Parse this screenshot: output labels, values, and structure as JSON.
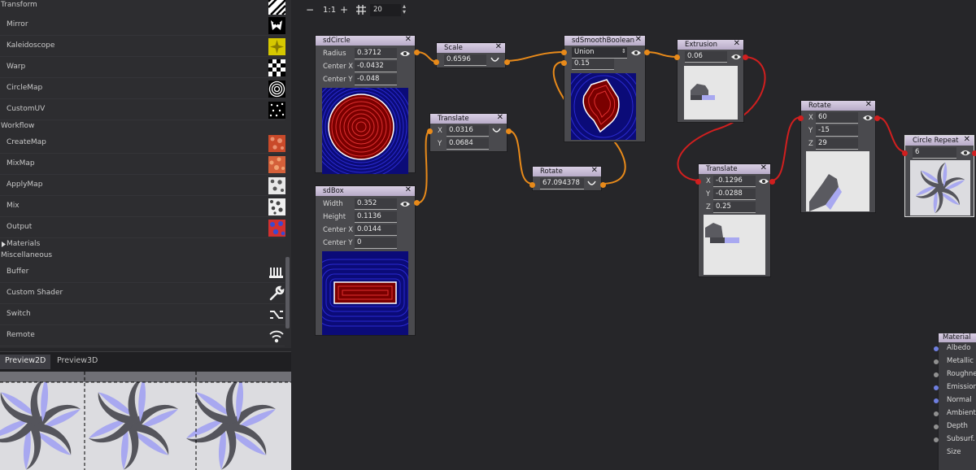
{
  "library": {
    "rows": [
      {
        "label": "Transform",
        "kind": "category"
      },
      {
        "label": "Mirror",
        "icon": "mirror-thumb-icon"
      },
      {
        "label": "Kaleidoscope",
        "icon": "kaleidoscope-thumb-icon"
      },
      {
        "label": "Warp",
        "icon": "warp-thumb-icon"
      },
      {
        "label": "CircleMap",
        "icon": "circlemap-thumb-icon"
      },
      {
        "label": "CustomUV",
        "icon": "customuv-thumb-icon"
      },
      {
        "label": "Workflow",
        "kind": "category"
      },
      {
        "label": "CreateMap",
        "icon": "createmap-thumb-icon"
      },
      {
        "label": "MixMap",
        "icon": "mixmap-thumb-icon"
      },
      {
        "label": "ApplyMap",
        "icon": "applymap-thumb-icon"
      },
      {
        "label": "Mix",
        "icon": "mix-thumb-icon"
      },
      {
        "label": "Output",
        "icon": "output-thumb-icon"
      },
      {
        "label": "Materials",
        "kind": "collapsed-category"
      },
      {
        "label": "Miscellaneous",
        "kind": "category"
      },
      {
        "label": "Buffer",
        "icon": "buffer-icon"
      },
      {
        "label": "Custom Shader",
        "icon": "wrench-icon"
      },
      {
        "label": "Switch",
        "icon": "switch-icon"
      },
      {
        "label": "Remote",
        "icon": "remote-icon"
      }
    ]
  },
  "preview": {
    "tabs": [
      {
        "label": "Preview2D",
        "active": true
      },
      {
        "label": "Preview3D",
        "active": false
      }
    ]
  },
  "toolbar": {
    "zoom_out": "−",
    "zoom_reset": "1:1",
    "zoom_in": "+",
    "grid_icon": "snap-grid-icon",
    "grid_value": "20",
    "spin": "▲▼"
  },
  "nodes": {
    "sdcircle": {
      "title": "sdCircle",
      "params": [
        {
          "label": "Radius",
          "value": "0.3712"
        },
        {
          "label": "Center X",
          "value": "-0.0432"
        },
        {
          "label": "Center Y",
          "value": "-0.048"
        }
      ]
    },
    "sdbox": {
      "title": "sdBox",
      "params": [
        {
          "label": "Width",
          "value": "0.352"
        },
        {
          "label": "Height",
          "value": "0.1136"
        },
        {
          "label": "Center X",
          "value": "0.0144"
        },
        {
          "label": "Center Y",
          "value": "0"
        }
      ]
    },
    "scale": {
      "title": "Scale",
      "value": "0.6596"
    },
    "translate1": {
      "title": "Translate",
      "params": [
        {
          "label": "X",
          "value": "0.0316"
        },
        {
          "label": "Y",
          "value": "0.0684"
        }
      ]
    },
    "rotate1": {
      "title": "Rotate",
      "value": "67.094378"
    },
    "smoothbool": {
      "title": "sdSmoothBoolean",
      "op": "Union",
      "value": "0.15"
    },
    "extrusion": {
      "title": "Extrusion",
      "value": "0.06"
    },
    "translate2": {
      "title": "Translate",
      "params": [
        {
          "label": "X",
          "value": "-0.1296"
        },
        {
          "label": "Y",
          "value": "-0.0288"
        },
        {
          "label": "Z",
          "value": "0.25"
        }
      ]
    },
    "rotate2": {
      "title": "Rotate",
      "params": [
        {
          "label": "X",
          "value": "60"
        },
        {
          "label": "Y",
          "value": "-15"
        },
        {
          "label": "Z",
          "value": "29"
        }
      ]
    },
    "circlerepeat": {
      "title": "Circle Repeat",
      "value": "6"
    }
  },
  "material": {
    "title": "Material",
    "inputs": [
      {
        "label": "Albedo",
        "connected": true
      },
      {
        "label": "Metallic",
        "connected": false
      },
      {
        "label": "Roughness",
        "connected": false
      },
      {
        "label": "Emission",
        "connected": true
      },
      {
        "label": "Normal",
        "connected": true
      },
      {
        "label": "Ambient",
        "connected": false
      },
      {
        "label": "Depth",
        "connected": false
      },
      {
        "label": "Subsurf. S",
        "connected": false
      },
      {
        "label": "Size",
        "connected": false
      }
    ]
  },
  "colors": {
    "wire_orange": "#e88a1a",
    "wire_red": "#d11f1f",
    "node_title": "#cbbfd9",
    "port_blue": "#6f7fe0"
  }
}
